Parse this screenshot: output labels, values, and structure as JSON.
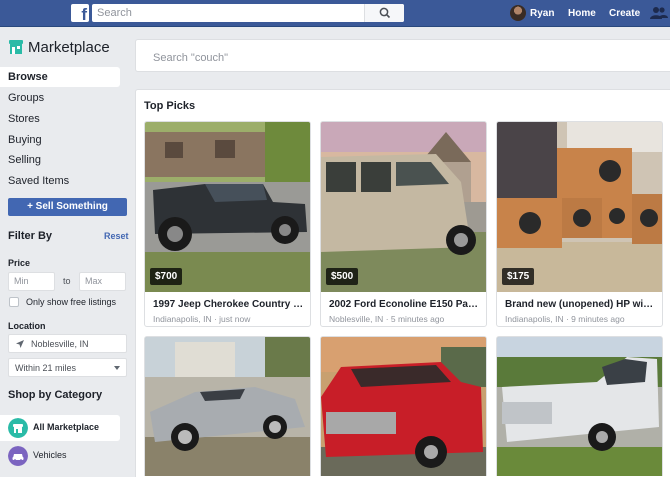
{
  "topbar": {
    "search_placeholder": "Search",
    "user_name": "Ryan",
    "home_label": "Home",
    "create_label": "Create",
    "color": "#3b5998"
  },
  "sidebar": {
    "title": "Marketplace",
    "nav": [
      "Browse",
      "Groups",
      "Stores",
      "Buying",
      "Selling",
      "Saved Items"
    ],
    "sell_button": "+ Sell Something",
    "filter_title": "Filter By",
    "reset": "Reset",
    "price_label": "Price",
    "min_placeholder": "Min",
    "to_label": "to",
    "max_placeholder": "Max",
    "free_label": "Only show free listings",
    "location_label": "Location",
    "location_value": "Noblesville, IN",
    "radius_value": "Within 21 miles",
    "category_title": "Shop by Category",
    "categories": [
      {
        "label": "All Marketplace",
        "icon": "storefront-icon",
        "color": "#2abba7"
      },
      {
        "label": "Vehicles",
        "icon": "car-icon",
        "color": "#7b64c0"
      }
    ]
  },
  "main": {
    "search_placeholder": "Search \"couch\"",
    "section_title": "Top Picks",
    "listings": [
      {
        "price": "$700",
        "title": "1997 Jeep Cherokee Country Sp...",
        "location": "Indianapolis, IN",
        "time": "just now"
      },
      {
        "price": "$500",
        "title": "2002 Ford Econoline E150 Pass...",
        "location": "Noblesville, IN",
        "time": "5 minutes ago"
      },
      {
        "price": "$175",
        "title": "Brand new (unopened) HP wind...",
        "location": "Indianapolis, IN",
        "time": "9 minutes ago"
      },
      {
        "image": "silver-convertible"
      },
      {
        "image": "red-pickup"
      },
      {
        "image": "white-pickup"
      }
    ]
  }
}
